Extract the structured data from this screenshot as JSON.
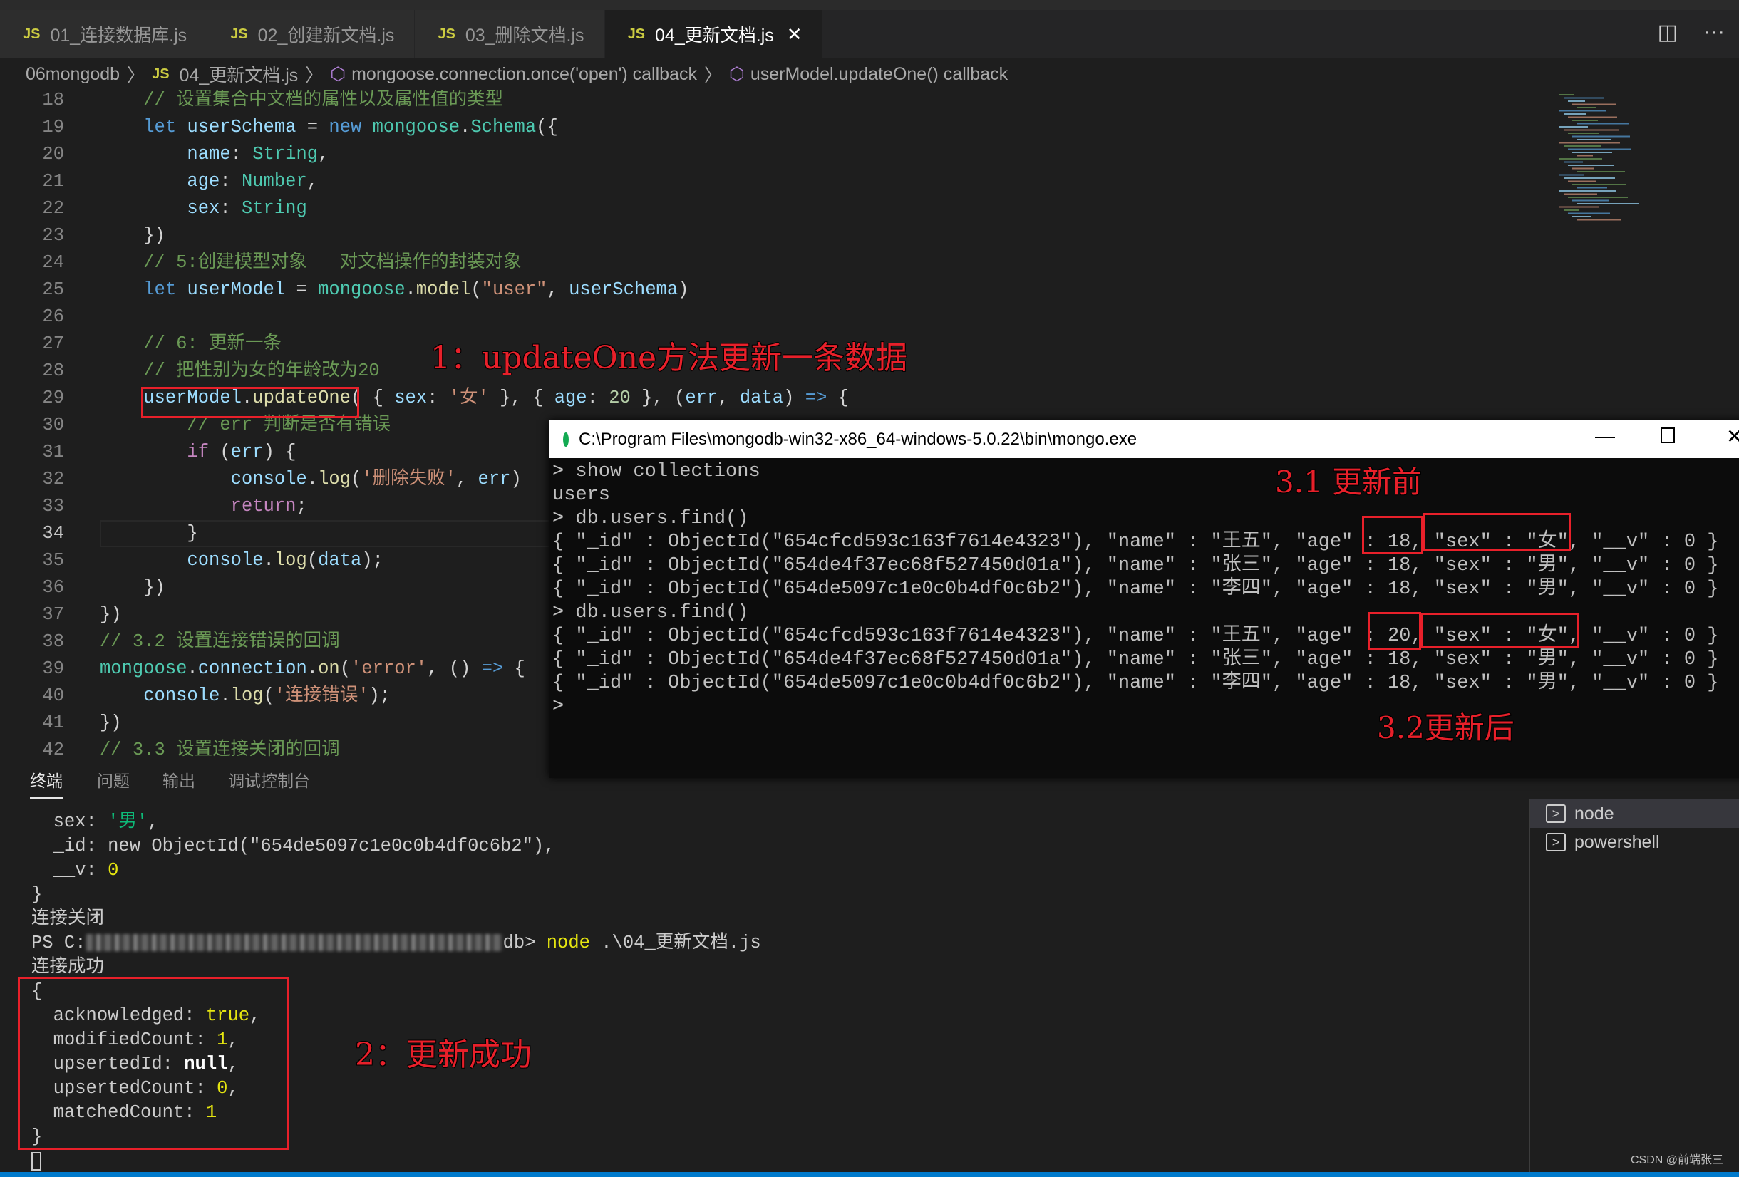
{
  "tabs": [
    {
      "label": "01_连接数据库.js",
      "active": false
    },
    {
      "label": "02_创建新文档.js",
      "active": false
    },
    {
      "label": "03_删除文档.js",
      "active": false
    },
    {
      "label": "04_更新文档.js",
      "active": true
    }
  ],
  "tab_icon_text": "JS",
  "tab_actions": {
    "split": "◫",
    "more": "···"
  },
  "breadcrumb": {
    "folder": "06mongodb",
    "file": "04_更新文档.js",
    "sym1": "mongoose.connection.once('open') callback",
    "sym2": "userModel.updateOne() callback"
  },
  "editor": {
    "current_line": 34,
    "lines": [
      {
        "n": "18",
        "tok": [
          [
            "    ",
            "pn"
          ],
          [
            "// 设置集合中文档的属性以及属性值的类型",
            "cmt"
          ]
        ]
      },
      {
        "n": "19",
        "tok": [
          [
            "    ",
            "pn"
          ],
          [
            "let ",
            "kw"
          ],
          [
            "userSchema",
            "var"
          ],
          [
            " = ",
            "pn"
          ],
          [
            "new ",
            "kw"
          ],
          [
            "mongoose",
            "cls"
          ],
          [
            ".",
            "pn"
          ],
          [
            "Schema",
            "cls"
          ],
          [
            "({",
            "pn"
          ]
        ]
      },
      {
        "n": "20",
        "tok": [
          [
            "        ",
            "pn"
          ],
          [
            "name",
            "var"
          ],
          [
            ": ",
            "pn"
          ],
          [
            "String",
            "cls"
          ],
          [
            ",",
            "pn"
          ]
        ]
      },
      {
        "n": "21",
        "tok": [
          [
            "        ",
            "pn"
          ],
          [
            "age",
            "var"
          ],
          [
            ": ",
            "pn"
          ],
          [
            "Number",
            "cls"
          ],
          [
            ",",
            "pn"
          ]
        ]
      },
      {
        "n": "22",
        "tok": [
          [
            "        ",
            "pn"
          ],
          [
            "sex",
            "var"
          ],
          [
            ": ",
            "pn"
          ],
          [
            "String",
            "cls"
          ]
        ]
      },
      {
        "n": "23",
        "tok": [
          [
            "    })",
            "pn"
          ]
        ]
      },
      {
        "n": "24",
        "tok": [
          [
            "    ",
            "pn"
          ],
          [
            "// 5:创建模型对象   对文档操作的封装对象",
            "cmt"
          ]
        ]
      },
      {
        "n": "25",
        "tok": [
          [
            "    ",
            "pn"
          ],
          [
            "let ",
            "kw"
          ],
          [
            "userModel",
            "var"
          ],
          [
            " = ",
            "pn"
          ],
          [
            "mongoose",
            "cls"
          ],
          [
            ".",
            "pn"
          ],
          [
            "model",
            "fn"
          ],
          [
            "(",
            "pn"
          ],
          [
            "\"user\"",
            "str"
          ],
          [
            ", ",
            "pn"
          ],
          [
            "userSchema",
            "var"
          ],
          [
            ")",
            "pn"
          ]
        ]
      },
      {
        "n": "26",
        "tok": []
      },
      {
        "n": "27",
        "tok": [
          [
            "    ",
            "pn"
          ],
          [
            "// 6: 更新一条",
            "cmt"
          ]
        ]
      },
      {
        "n": "28",
        "tok": [
          [
            "    ",
            "pn"
          ],
          [
            "// 把性别为女的年龄改为20",
            "cmt"
          ]
        ]
      },
      {
        "n": "29",
        "tok": [
          [
            "    ",
            "pn"
          ],
          [
            "userModel",
            "var"
          ],
          [
            ".",
            "pn"
          ],
          [
            "updateOne",
            "fn"
          ],
          [
            "( { ",
            "pn"
          ],
          [
            "sex",
            "var"
          ],
          [
            ": ",
            "pn"
          ],
          [
            "'女'",
            "str"
          ],
          [
            " }, { ",
            "pn"
          ],
          [
            "age",
            "var"
          ],
          [
            ": ",
            "pn"
          ],
          [
            "20",
            "num"
          ],
          [
            " }, (",
            "pn"
          ],
          [
            "err",
            "var"
          ],
          [
            ", ",
            "pn"
          ],
          [
            "data",
            "var"
          ],
          [
            ") ",
            "pn"
          ],
          [
            "=>",
            "kw"
          ],
          [
            " {",
            "pn"
          ]
        ]
      },
      {
        "n": "30",
        "tok": [
          [
            "        ",
            "pn"
          ],
          [
            "// err 判断是否有错误",
            "cmt"
          ]
        ]
      },
      {
        "n": "31",
        "tok": [
          [
            "        ",
            "pn"
          ],
          [
            "if",
            "ctl"
          ],
          [
            " (",
            "pn"
          ],
          [
            "err",
            "var"
          ],
          [
            ") {",
            "pn"
          ]
        ]
      },
      {
        "n": "32",
        "tok": [
          [
            "            ",
            "pn"
          ],
          [
            "console",
            "var"
          ],
          [
            ".",
            "pn"
          ],
          [
            "log",
            "fn"
          ],
          [
            "(",
            "pn"
          ],
          [
            "'删除失败'",
            "str"
          ],
          [
            ", ",
            "pn"
          ],
          [
            "err",
            "var"
          ],
          [
            ")",
            "pn"
          ]
        ]
      },
      {
        "n": "33",
        "tok": [
          [
            "            ",
            "pn"
          ],
          [
            "return",
            "ctl"
          ],
          [
            ";",
            "pn"
          ]
        ]
      },
      {
        "n": "34",
        "tok": [
          [
            "        }",
            "pn"
          ]
        ]
      },
      {
        "n": "35",
        "tok": [
          [
            "        ",
            "pn"
          ],
          [
            "console",
            "var"
          ],
          [
            ".",
            "pn"
          ],
          [
            "log",
            "fn"
          ],
          [
            "(",
            "pn"
          ],
          [
            "data",
            "var"
          ],
          [
            ");",
            "pn"
          ]
        ]
      },
      {
        "n": "36",
        "tok": [
          [
            "    })",
            "pn"
          ]
        ]
      },
      {
        "n": "37",
        "tok": [
          [
            "})",
            "pn"
          ]
        ]
      },
      {
        "n": "38",
        "tok": [
          [
            "// 3.2 设置连接错误的回调",
            "cmt"
          ]
        ]
      },
      {
        "n": "39",
        "tok": [
          [
            "mongoose",
            "cls"
          ],
          [
            ".",
            "pn"
          ],
          [
            "connection",
            "var"
          ],
          [
            ".",
            "pn"
          ],
          [
            "on",
            "fn"
          ],
          [
            "(",
            "pn"
          ],
          [
            "'error'",
            "str"
          ],
          [
            ", () ",
            "pn"
          ],
          [
            "=>",
            "kw"
          ],
          [
            " {",
            "pn"
          ]
        ]
      },
      {
        "n": "40",
        "tok": [
          [
            "    ",
            "pn"
          ],
          [
            "console",
            "var"
          ],
          [
            ".",
            "pn"
          ],
          [
            "log",
            "fn"
          ],
          [
            "(",
            "pn"
          ],
          [
            "'连接错误'",
            "str"
          ],
          [
            ");",
            "pn"
          ]
        ]
      },
      {
        "n": "41",
        "tok": [
          [
            "})",
            "pn"
          ]
        ]
      },
      {
        "n": "42",
        "tok": [
          [
            "// 3.3 设置连接关闭的回调",
            "cmt"
          ]
        ]
      }
    ]
  },
  "panel": {
    "tabs": [
      "终端",
      "问题",
      "输出",
      "调试控制台"
    ],
    "terminal": {
      "l1": [
        "  sex: ",
        "'男'",
        ","
      ],
      "l2": "  _id: new ObjectId(\"654de5097c1e0c0b4df0c6b2\"),",
      "l3": [
        "  __v: ",
        "0"
      ],
      "l4": "}",
      "l5": "连接关闭",
      "ps_prefix": "PS C:",
      "ps_suffix": "db> ",
      "cmd": "node",
      "cmd_arg": " .\\04_更新文档.js",
      "l7": "连接成功",
      "l8": "{",
      "ack": [
        "  acknowledged: ",
        "true",
        ","
      ],
      "mod": [
        "  modifiedCount: ",
        "1",
        ","
      ],
      "upid": [
        "  upsertedId: ",
        "null",
        ","
      ],
      "upc": [
        "  upsertedCount: ",
        "0",
        ","
      ],
      "mat": [
        "  matchedCount: ",
        "1"
      ],
      "l14": "}"
    },
    "terminal_list": [
      "node",
      "powershell"
    ]
  },
  "mongo_window": {
    "title": "C:\\Program Files\\mongodb-win32-x86_64-windows-5.0.22\\bin\\mongo.exe",
    "lines": [
      "> show collections",
      "users",
      "> db.users.find()",
      "{ \"_id\" : ObjectId(\"654cfcd593c163f7614e4323\"), \"name\" : \"王五\", \"age\" : 18, \"sex\" : \"女\", \"__v\" : 0 }",
      "{ \"_id\" : ObjectId(\"654de4f37ec68f527450d01a\"), \"name\" : \"张三\", \"age\" : 18, \"sex\" : \"男\", \"__v\" : 0 }",
      "{ \"_id\" : ObjectId(\"654de5097c1e0c0b4df0c6b2\"), \"name\" : \"李四\", \"age\" : 18, \"sex\" : \"男\", \"__v\" : 0 }",
      "> db.users.find()",
      "{ \"_id\" : ObjectId(\"654cfcd593c163f7614e4323\"), \"name\" : \"王五\", \"age\" : 20, \"sex\" : \"女\", \"__v\" : 0 }",
      "{ \"_id\" : ObjectId(\"654de4f37ec68f527450d01a\"), \"name\" : \"张三\", \"age\" : 18, \"sex\" : \"男\", \"__v\" : 0 }",
      "{ \"_id\" : ObjectId(\"654de5097c1e0c0b4df0c6b2\"), \"name\" : \"李四\", \"age\" : 18, \"sex\" : \"男\", \"__v\" : 0 }",
      ">"
    ]
  },
  "annotations": {
    "a1": "1：updateOne方法更新一条数据",
    "a2": "2：更新成功",
    "a31": "3.1 更新前",
    "a32": "3.2更新后",
    "color": "#e8202a"
  },
  "watermark": "CSDN @前端张三"
}
